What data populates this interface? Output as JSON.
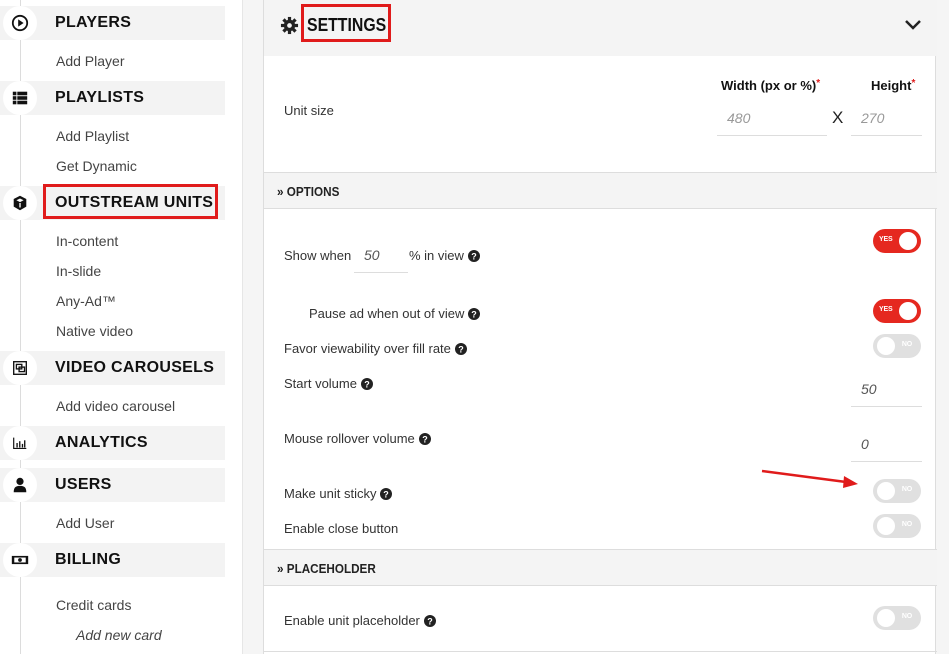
{
  "sidebar": {
    "sections": [
      {
        "title": "PLAYERS",
        "icon": "play-circle-icon",
        "items": [
          "Add Player"
        ]
      },
      {
        "title": "PLAYLISTS",
        "icon": "list-icon",
        "items": [
          "Add Playlist",
          "Get Dynamic"
        ]
      },
      {
        "title": "OUTSTREAM UNITS",
        "icon": "cube-icon",
        "highlighted": true,
        "items": [
          "In-content",
          "In-slide",
          "Any-Ad™",
          "Native video"
        ]
      },
      {
        "title": "VIDEO CAROUSELS",
        "icon": "carousel-icon",
        "items": [
          "Add video carousel"
        ]
      },
      {
        "title": "ANALYTICS",
        "icon": "bar-chart-icon",
        "items": []
      },
      {
        "title": "USERS",
        "icon": "user-icon",
        "items": [
          "Add User"
        ]
      },
      {
        "title": "BILLING",
        "icon": "money-bill-icon",
        "items": [
          "Credit cards",
          "Add new card"
        ]
      }
    ]
  },
  "settings": {
    "title": "SETTINGS",
    "icon": "gear-icon",
    "collapse_icon": "chevron-down-icon",
    "unit_size": {
      "label": "Unit size",
      "width_label": "Width (px or %)",
      "height_label": "Height",
      "required_mark": "*",
      "width_placeholder": "480",
      "height_placeholder": "270",
      "separator": "X"
    },
    "options": {
      "title": "OPTIONS",
      "show_when_prefix": "Show when",
      "show_when_value": "50",
      "show_when_suffix": "% in view",
      "show_when_toggle": "YES",
      "pause_label": "Pause ad when out of view",
      "pause_toggle": "YES",
      "favor_label": "Favor viewability over fill rate",
      "favor_toggle": "NO",
      "start_volume_label": "Start volume",
      "start_volume_value": "50",
      "rollover_label": "Mouse rollover volume",
      "rollover_value": "0",
      "sticky_label": "Make unit sticky",
      "sticky_toggle": "NO",
      "close_label": "Enable close button",
      "close_toggle": "NO"
    },
    "placeholder": {
      "title": "PLACEHOLDER",
      "enable_label": "Enable unit placeholder",
      "enable_toggle": "NO"
    }
  },
  "colors": {
    "accent": "#e5281f",
    "highlight_box": "#e01b1b",
    "toggle_off": "#e0e0e0",
    "band_bg": "#f4f4f4"
  }
}
